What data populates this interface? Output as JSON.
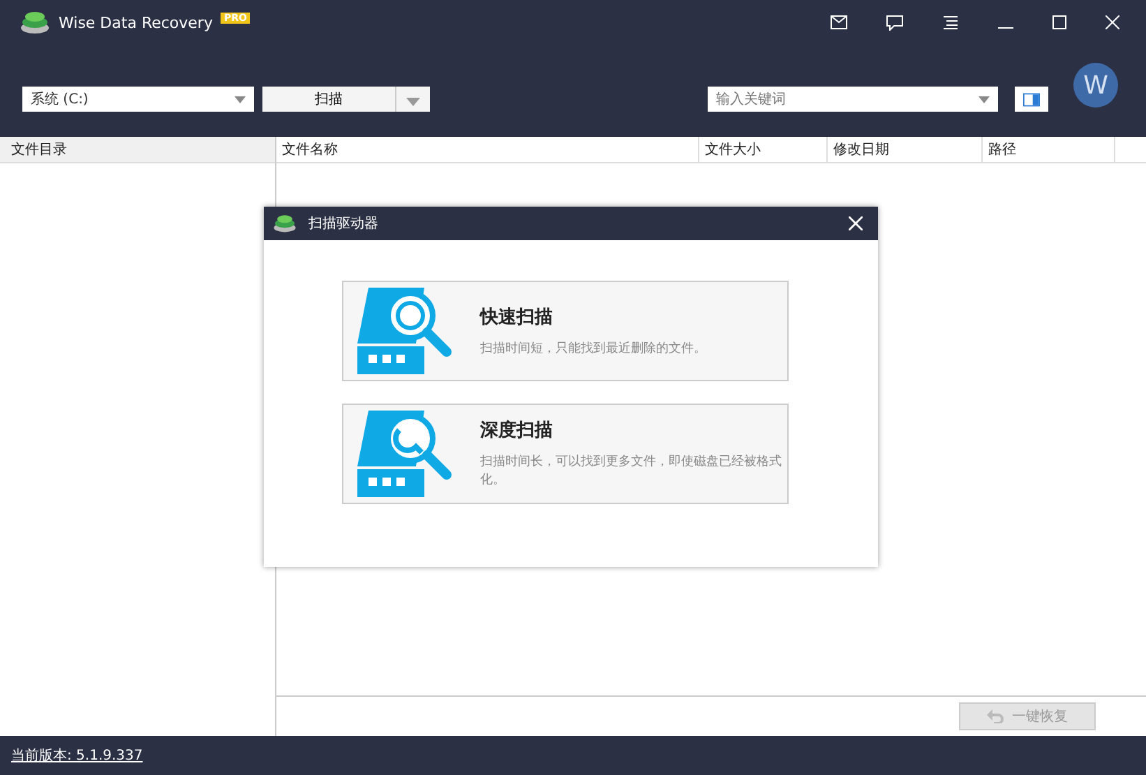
{
  "window": {
    "title": "Wise Data Recovery",
    "badge": "PRO"
  },
  "toolbar": {
    "drive": "系统 (C:)",
    "scan_button": "扫描",
    "search": {
      "placeholder": "输入关键词"
    }
  },
  "avatar": {
    "letter": "W"
  },
  "sidebar": {
    "header": "文件目录"
  },
  "table": {
    "columns": [
      "文件名称",
      "文件大小",
      "修改日期",
      "路径"
    ]
  },
  "dialog": {
    "title": "扫描驱动器",
    "options": [
      {
        "kind": "quick",
        "title": "快速扫描",
        "description": "扫描时间短，只能找到最近删除的文件。"
      },
      {
        "kind": "deep",
        "title": "深度扫描",
        "description": "扫描时间长，可以找到更多文件，即使磁盘已经被格式化。"
      }
    ]
  },
  "recover_button": {
    "label": "一键恢复",
    "disabled": true
  },
  "status_bar": {
    "version": "当前版本: 5.1.9.337"
  }
}
